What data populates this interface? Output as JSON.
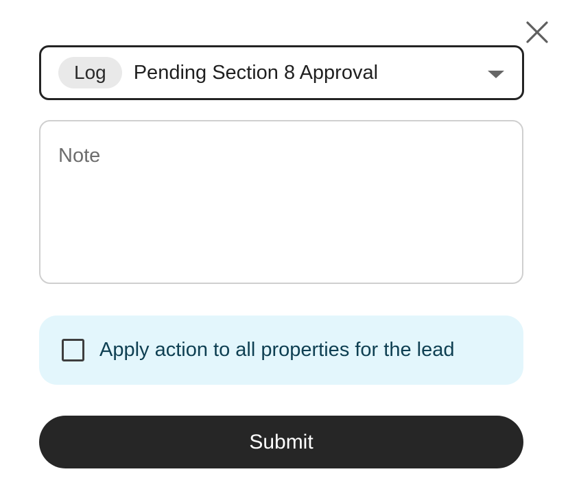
{
  "dialog": {
    "close_icon": "close-icon"
  },
  "action_select": {
    "type_chip": "Log",
    "selected_value": "Pending Section 8 Approval",
    "arrow_icon": "caret-down-icon"
  },
  "note": {
    "placeholder": "Note",
    "value": ""
  },
  "apply_all": {
    "checked": false,
    "label": "Apply action to all properties for the lead"
  },
  "submit": {
    "label": "Submit"
  },
  "colors": {
    "primary": "#262626",
    "info_background": "#e3f6fc",
    "info_text": "#0e3f52",
    "chip_background": "#e9e9e9"
  }
}
